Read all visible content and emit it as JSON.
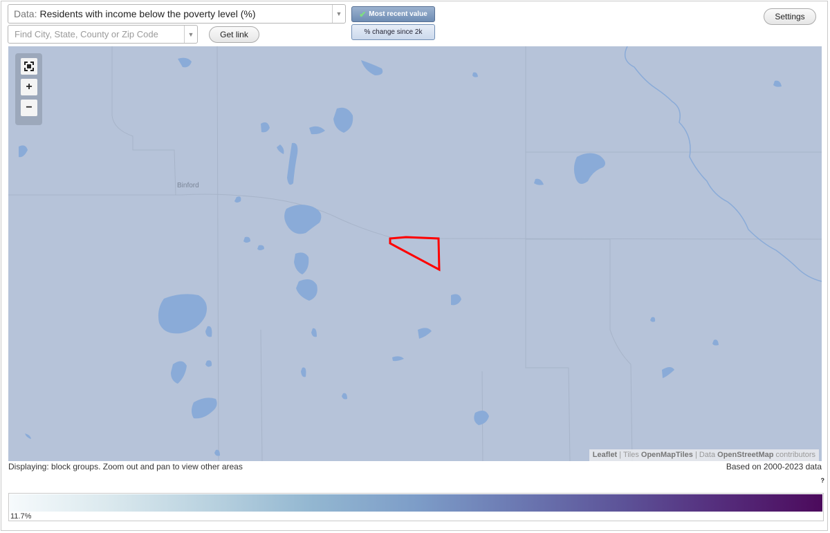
{
  "toolbar": {
    "data_prefix": "Data:",
    "data_value": "Residents with income below the poverty level (%)",
    "search_placeholder": "Find City, State, County or Zip Code",
    "get_link_label": "Get link",
    "mode_recent_label": "Most recent value",
    "mode_change_label": "% change since 2k",
    "settings_label": "Settings"
  },
  "map": {
    "place_labels": [
      "Binford"
    ],
    "highlight_color": "#ff0000",
    "water_color": "#8aabd8",
    "land_color": "#b6c3d9",
    "attribution": {
      "leaflet": "Leaflet",
      "tiles_prefix": "| Tiles",
      "tiles_link": "OpenMapTiles",
      "data_prefix": "| Data",
      "data_link": "OpenStreetMap",
      "data_suffix": "contributors"
    }
  },
  "status": {
    "displaying": "Displaying: block groups. Zoom out and pan to view other areas",
    "based_on": "Based on 2000-2023 data",
    "help": "?"
  },
  "legend": {
    "min_label": "11.7%"
  },
  "colors": {
    "mode_active": "#6f8db4",
    "legend_start": "#f6fafc",
    "legend_end": "#4c0a5c"
  }
}
